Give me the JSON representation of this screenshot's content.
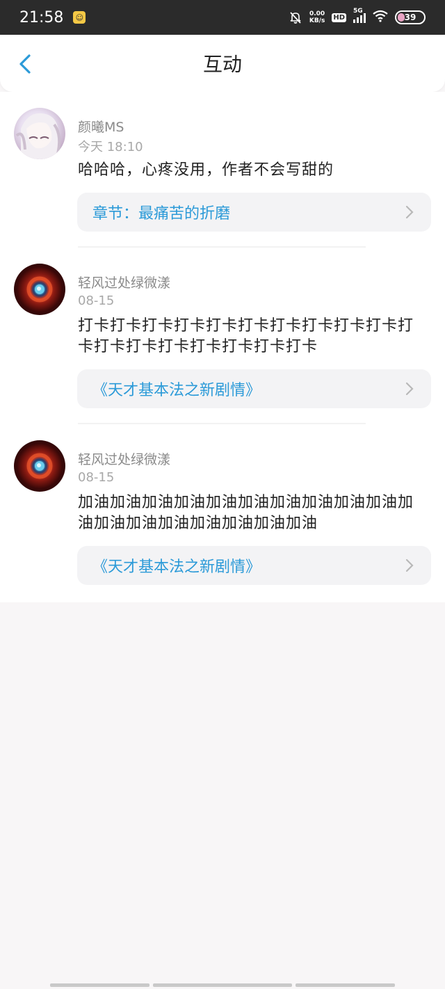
{
  "status_bar": {
    "time": "21:58",
    "app_badge_icon": "cat-face-icon",
    "net_speed_value": "0.00",
    "net_speed_unit": "KB/s",
    "hd_label": "HD",
    "network_label": "5G",
    "battery_level": "39",
    "battery_fill_color": "#e9a4c4"
  },
  "header": {
    "title": "互动",
    "back_icon": "chevron-left-icon",
    "accent": "#2b9ad8"
  },
  "items": [
    {
      "user": "颜曦MS",
      "time": "今天  18:10",
      "text": "哈哈哈，心疼没用，作者不会写甜的",
      "source": "章节：最痛苦的折磨"
    },
    {
      "user": "轻风过处绿微漾",
      "time": "08-15",
      "text": "打卡打卡打卡打卡打卡打卡打卡打卡打卡打卡打卡打卡打卡打卡打卡打卡打卡打卡",
      "source": "《天才基本法之新剧情》"
    },
    {
      "user": "轻风过处绿微漾",
      "time": "08-15",
      "text": "加油加油加油加油加油加油加油加油加油加油加油加油加油加油加油加油加油加油",
      "source": "《天才基本法之新剧情》"
    }
  ]
}
